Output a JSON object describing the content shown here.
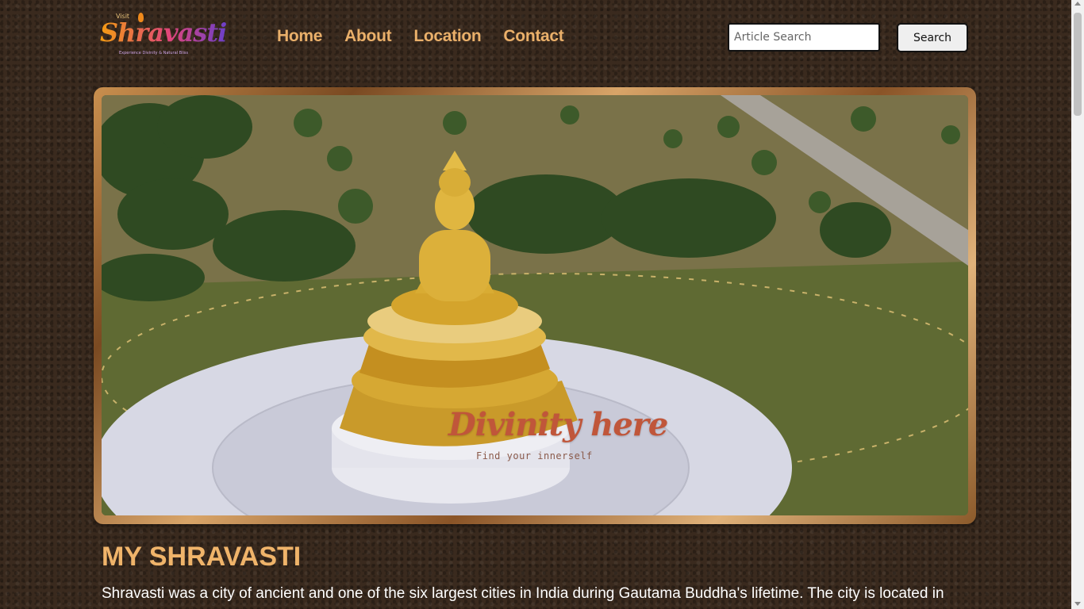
{
  "header": {
    "logo": {
      "visit": "Visit",
      "brand": "Shravasti",
      "tagline": "Experience Divinity & Natural Bliss"
    },
    "nav": [
      "Home",
      "About",
      "Location",
      "Contact"
    ],
    "search": {
      "placeholder": "Article Search",
      "value": "",
      "button_label": "Search"
    }
  },
  "hero": {
    "overlay_title": "Divinity here",
    "overlay_subtitle": "Find your innerself",
    "frame_color": "#c98f4e"
  },
  "main": {
    "title": "MY SHRAVASTI",
    "intro": "Shravasti was a city of ancient and one of the six largest cities in India during Gautama Buddha's lifetime. The city is located in"
  },
  "colors": {
    "accent": "#f0b46a",
    "nav": "#eab06a",
    "background": "#3a2a1e"
  }
}
